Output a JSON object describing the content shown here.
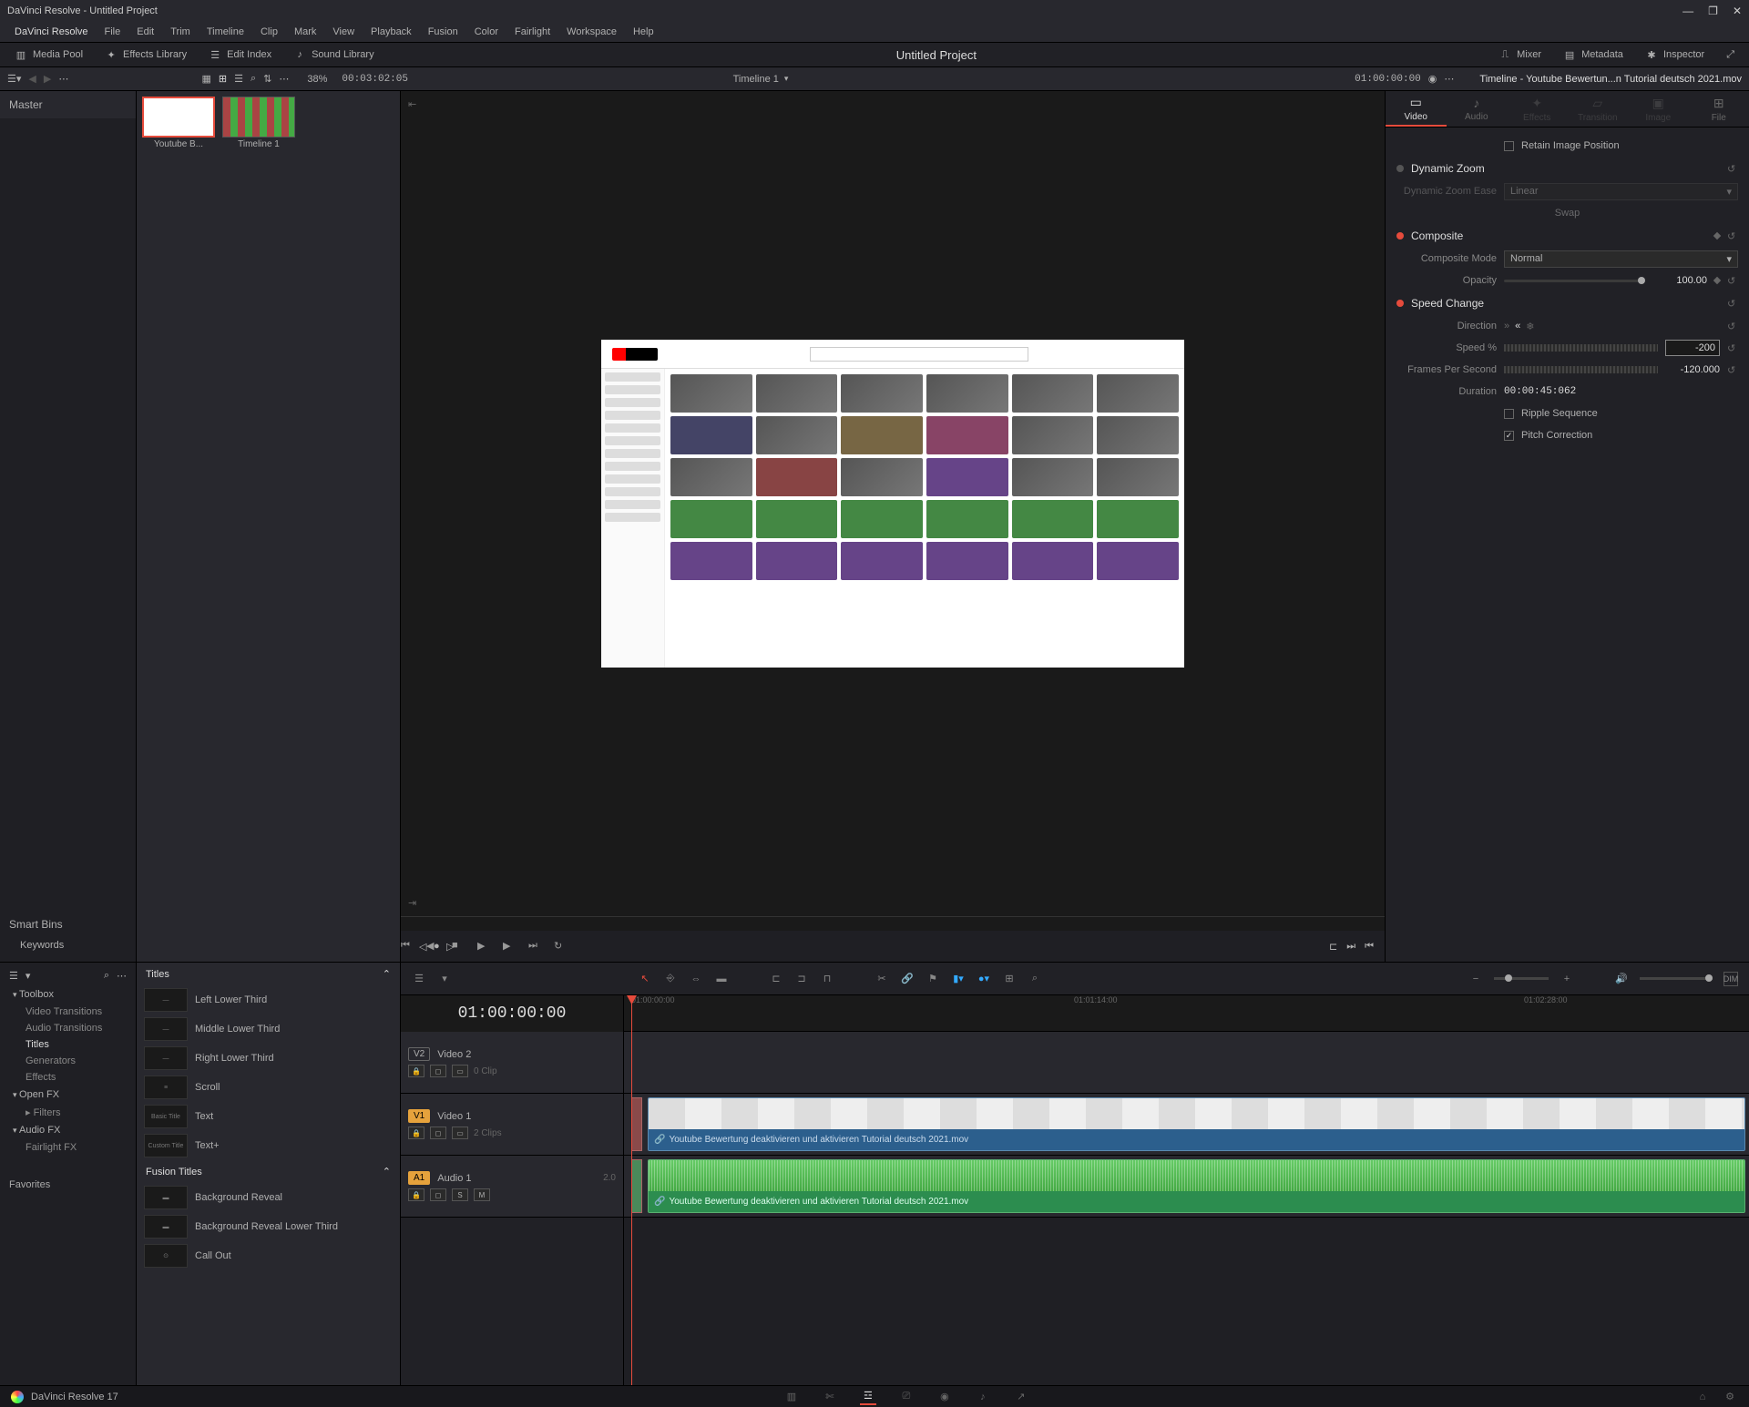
{
  "window": {
    "title": "DaVinci Resolve - Untitled Project"
  },
  "menu": {
    "app": "DaVinci Resolve",
    "items": [
      "File",
      "Edit",
      "Trim",
      "Timeline",
      "Clip",
      "Mark",
      "View",
      "Playback",
      "Fusion",
      "Color",
      "Fairlight",
      "Workspace",
      "Help"
    ]
  },
  "toolbar": {
    "mediaPool": "Media Pool",
    "effectsLibrary": "Effects Library",
    "editIndex": "Edit Index",
    "soundLibrary": "Sound Library",
    "projectTitle": "Untitled Project",
    "mixer": "Mixer",
    "metadata": "Metadata",
    "inspector": "Inspector"
  },
  "toolbar2": {
    "zoom": "38%",
    "viewerTimecode": "00:03:02:05",
    "timelineName": "Timeline 1",
    "recordTimecode": "01:00:00:00",
    "inspectorTitle": "Timeline - Youtube Bewertun...n Tutorial deutsch 2021.mov"
  },
  "mediaPool": {
    "master": "Master",
    "smartBins": "Smart Bins",
    "keywords": "Keywords",
    "clips": [
      {
        "name": "Youtube B..."
      },
      {
        "name": "Timeline 1"
      }
    ]
  },
  "effectsLib": {
    "toolbox": "Toolbox",
    "videoTransitions": "Video Transitions",
    "audioTransitions": "Audio Transitions",
    "titles": "Titles",
    "generators": "Generators",
    "effects": "Effects",
    "openFX": "Open FX",
    "filters": "Filters",
    "audioFX": "Audio FX",
    "fairlightFX": "Fairlight FX",
    "favorites": "Favorites"
  },
  "titlesPanel": {
    "header": "Titles",
    "items": [
      "Left Lower Third",
      "Middle Lower Third",
      "Right Lower Third",
      "Scroll",
      "Text",
      "Text+"
    ],
    "fusionHeader": "Fusion Titles",
    "fusionItems": [
      "Background Reveal",
      "Background Reveal Lower Third",
      "Call Out"
    ]
  },
  "inspector": {
    "tabs": {
      "video": "Video",
      "audio": "Audio",
      "effects": "Effects",
      "transition": "Transition",
      "image": "Image",
      "file": "File"
    },
    "retainImagePosition": "Retain Image Position",
    "dynamicZoom": {
      "title": "Dynamic Zoom",
      "easeLabel": "Dynamic Zoom Ease",
      "easeValue": "Linear",
      "swap": "Swap"
    },
    "composite": {
      "title": "Composite",
      "modeLabel": "Composite Mode",
      "modeValue": "Normal",
      "opacityLabel": "Opacity",
      "opacityValue": "100.00"
    },
    "speed": {
      "title": "Speed Change",
      "directionLabel": "Direction",
      "speedLabel": "Speed %",
      "speedValue": "-200",
      "fpsLabel": "Frames Per Second",
      "fpsValue": "-120.000",
      "durationLabel": "Duration",
      "durationValue": "00:00:45:062",
      "ripple": "Ripple Sequence",
      "pitch": "Pitch Correction"
    }
  },
  "timeline": {
    "timecode": "01:00:00:00",
    "ruler": [
      "01:00:00:00",
      "01:01:14:00",
      "01:02:28:00"
    ],
    "tracks": {
      "v2": {
        "badge": "V2",
        "name": "Video 2",
        "clips": "0 Clip"
      },
      "v1": {
        "badge": "V1",
        "name": "Video 1",
        "clips": "2 Clips"
      },
      "a1": {
        "badge": "A1",
        "name": "Audio 1",
        "ch": "2.0"
      }
    },
    "clipName": "Youtube Bewertung deaktivieren und aktivieren Tutorial deutsch 2021.mov"
  },
  "bottomBar": {
    "version": "DaVinci Resolve 17"
  }
}
